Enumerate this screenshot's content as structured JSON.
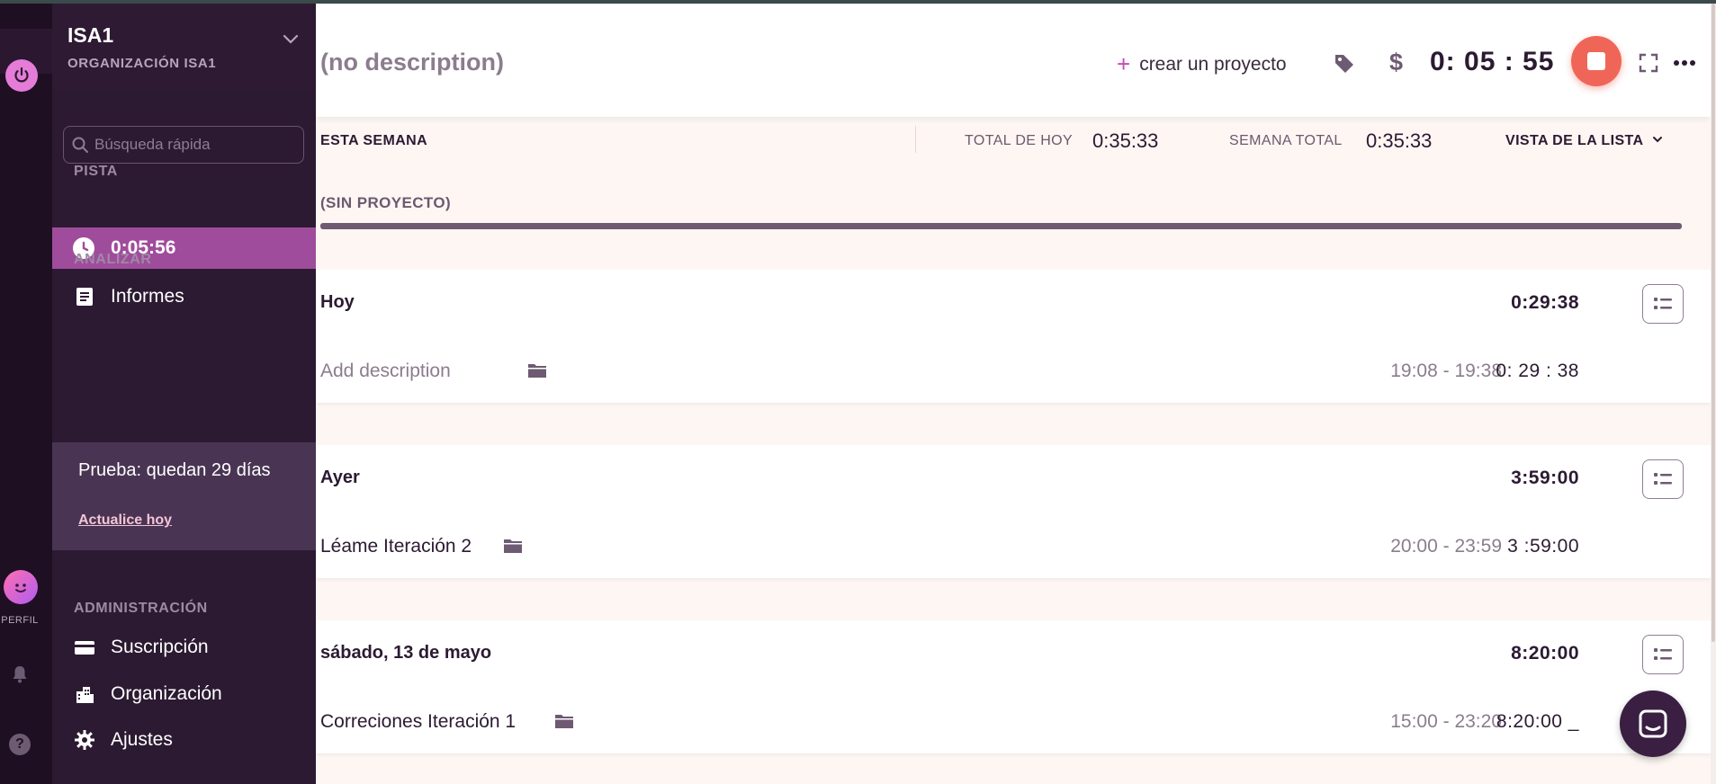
{
  "rail": {
    "profile_label": "PERFIL",
    "help_glyph": "?"
  },
  "sidebar": {
    "org_name": "ISA1",
    "org_subtitle": "ORGANIZACIÓN ISA1",
    "search_placeholder": "Búsqueda rápida",
    "section_track": "PISTA",
    "active_timer": "0:05:56",
    "section_analyze": "ANALIZAR",
    "reports_label": "Informes",
    "trial_text": "Prueba: quedan 29 días",
    "trial_link": "Actualice hoy",
    "section_admin": "ADMINISTRACIÓN",
    "subscription_label": "Suscripción",
    "organization_label": "Organización",
    "settings_label": "Ajustes"
  },
  "header": {
    "description": "(no description)",
    "create_project_plus": "+",
    "create_project_label": "crear un proyecto",
    "dollar_glyph": "$",
    "timer": "0: 05 : 55"
  },
  "summary": {
    "week_label": "ESTA SEMANA",
    "today_total_label": "TOTAL DE HOY",
    "today_total_value": "0:35:33",
    "week_total_label": "SEMANA TOTAL",
    "week_total_value": "0:35:33",
    "view_label": "VISTA DE LA LISTA"
  },
  "project_breakdown": {
    "label": "(SIN PROYECTO)"
  },
  "days": [
    {
      "name": "Hoy",
      "total": "0:29:38",
      "entry": {
        "description": "Add description",
        "is_placeholder": true,
        "range": "19:08 - 19:38",
        "duration": "0: 29 : 38"
      }
    },
    {
      "name": "Ayer",
      "total": "3:59:00",
      "entry": {
        "description": "Léame Iteración 2",
        "is_placeholder": false,
        "range": "20:00 - 23:59",
        "duration": "3 :59:00"
      }
    },
    {
      "name": "sábado, 13 de mayo",
      "total": "8:20:00",
      "entry": {
        "description": "Correciones Iteración 1",
        "is_placeholder": false,
        "range": "15:00 - 23:20",
        "duration": "8:20:00 _"
      }
    }
  ],
  "colors": {
    "accent": "#a04c9c",
    "sidebar_bg": "#2c1a32",
    "stop_button": "#ef6658"
  },
  "icons": [
    "power-icon",
    "search-icon",
    "clock-icon",
    "report-icon",
    "card-icon",
    "building-icon",
    "gear-icon",
    "bell-icon",
    "help-icon",
    "tag-icon",
    "expand-icon",
    "more-icon",
    "list-icon",
    "folder-icon",
    "chat-icon",
    "chevron-down-icon"
  ]
}
